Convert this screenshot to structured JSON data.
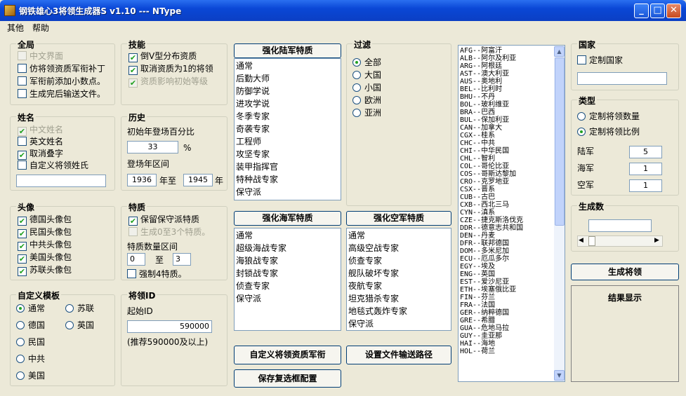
{
  "window": {
    "title": "钢铁雄心3将领生成器S v1.10 --- NType",
    "min": "_",
    "max": "□",
    "close": "✕"
  },
  "menu": [
    "其他",
    "帮助"
  ],
  "global": {
    "label": "全局",
    "items": [
      {
        "text": "中文界面",
        "checked": false,
        "disabled": true
      },
      {
        "text": "仿将领资质军衔补丁",
        "checked": false,
        "disabled": false
      },
      {
        "text": "军衔前添加小数点。",
        "checked": false,
        "disabled": false
      },
      {
        "text": "生成完后输送文件。",
        "checked": false,
        "disabled": false
      }
    ]
  },
  "skill": {
    "label": "技能",
    "items": [
      {
        "text": "倒V型分布资质",
        "checked": true,
        "disabled": false
      },
      {
        "text": "取消资质为1的将领",
        "checked": true,
        "disabled": false
      },
      {
        "text": "资质影响初始等级",
        "checked": true,
        "disabled": true
      }
    ]
  },
  "name": {
    "label": "姓名",
    "items": [
      {
        "text": "中文姓名",
        "checked": true,
        "disabled": true
      },
      {
        "text": "英文姓名",
        "checked": false,
        "disabled": false
      },
      {
        "text": "取消叠字",
        "checked": true,
        "disabled": false
      },
      {
        "text": "自定义将领姓氏",
        "checked": false,
        "disabled": false
      }
    ],
    "input": ""
  },
  "history": {
    "label": "历史",
    "pct_label": "初始年登场百分比",
    "pct": "33",
    "pct_unit": "%",
    "range_label": "登场年区间",
    "from": "1936",
    "to_label": "年至",
    "to": "1945",
    "year": "年"
  },
  "portrait": {
    "label": "头像",
    "items": [
      {
        "text": "德国头像包",
        "checked": true
      },
      {
        "text": "民国头像包",
        "checked": true
      },
      {
        "text": "中共头像包",
        "checked": true
      },
      {
        "text": "美国头像包",
        "checked": true
      },
      {
        "text": "苏联头像包",
        "checked": true
      }
    ]
  },
  "trait": {
    "label": "特质",
    "items": [
      {
        "text": "保留保守派特质",
        "checked": true,
        "disabled": false
      },
      {
        "text": "生成0至3个特质。",
        "checked": false,
        "disabled": true
      }
    ],
    "range_label": "特质数量区间",
    "min": "0",
    "to": "至",
    "max": "3",
    "force": "强制4特质。",
    "force_checked": false
  },
  "template": {
    "label": "自定义模板",
    "left": [
      "通常",
      "德国",
      "民国",
      "中共",
      "美国"
    ],
    "right": [
      "苏联",
      "英国"
    ],
    "selected": "通常"
  },
  "general_id": {
    "label": "将领ID",
    "start_label": "起始ID",
    "value": "590000",
    "hint": "(推荐590000及以上)"
  },
  "army": {
    "header": "强化陆军特质",
    "items": [
      "通常",
      "后勤大师",
      "防御学说",
      "进攻学说",
      "冬季专家",
      "奇袭专家",
      "工程师",
      "攻坚专家",
      "装甲指挥官",
      "特种战专家",
      "保守派"
    ]
  },
  "navy": {
    "header": "强化海军特质",
    "items": [
      "通常",
      "超级海战专家",
      "海狼战专家",
      "封锁战专家",
      "侦查专家",
      "保守派"
    ]
  },
  "air": {
    "header": "强化空军特质",
    "items": [
      "通常",
      "高级空战专家",
      "侦查专家",
      "舰队破坏专家",
      "夜航专家",
      "坦克猎杀专家",
      "地毯式轰炸专家",
      "保守派"
    ]
  },
  "filter": {
    "label": "过滤",
    "options": [
      "全部",
      "大国",
      "小国",
      "欧洲",
      "亚洲"
    ],
    "selected": "全部"
  },
  "buttons": {
    "custom_rank": "自定义将领资质军衔",
    "set_path": "设置文件输送路径",
    "save_config": "保存复选框配置",
    "generate": "生成将领"
  },
  "countries": [
    "AFG--阿富汗",
    "ALB--阿尔及利亚",
    "ARG--阿根廷",
    "AST--澳大利亚",
    "AUS--奥地利",
    "BEL--比利时",
    "BHU--不丹",
    "BOL--玻利维亚",
    "BRA--巴西",
    "BUL--保加利亚",
    "CAN--加拿大",
    "CGX--桂系",
    "CHC--中共",
    "CHI--中华民国",
    "CHL--智利",
    "COL--哥伦比亚",
    "COS--哥斯达黎加",
    "CRO--克罗地亚",
    "CSX--晋系",
    "CUB--古巴",
    "CXB--西北三马",
    "CYN--滇系",
    "CZE--捷克斯洛伐克",
    "DDR--德意志共和国",
    "DEN--丹麦",
    "DFR--联邦德国",
    "DOM--多米尼加",
    "ECU--厄瓜多尔",
    "EGY--埃及",
    "ENG--英国",
    "EST--爱沙尼亚",
    "ETH--埃塞俄比亚",
    "FIN--芬兰",
    "FRA--法国",
    "GER--纳粹德国",
    "GRE--希腊",
    "GUA--危地马拉",
    "GUY--圭亚那",
    "HAI--海地",
    "HOL--荷兰"
  ],
  "nation": {
    "label": "国家",
    "custom": "定制国家",
    "input": ""
  },
  "type": {
    "label": "类型",
    "options": [
      "定制将领数量",
      "定制将领比例"
    ],
    "selected": "定制将领比例",
    "army": "陆军",
    "army_val": "5",
    "navy": "海军",
    "navy_val": "1",
    "air": "空军",
    "air_val": "1"
  },
  "gen_count": {
    "label": "生成数",
    "input": ""
  },
  "result": {
    "label": "结果显示"
  },
  "colors": {
    "titlebar": "#0a47d6",
    "check": "#21a121",
    "bg": "#ece9d8"
  }
}
